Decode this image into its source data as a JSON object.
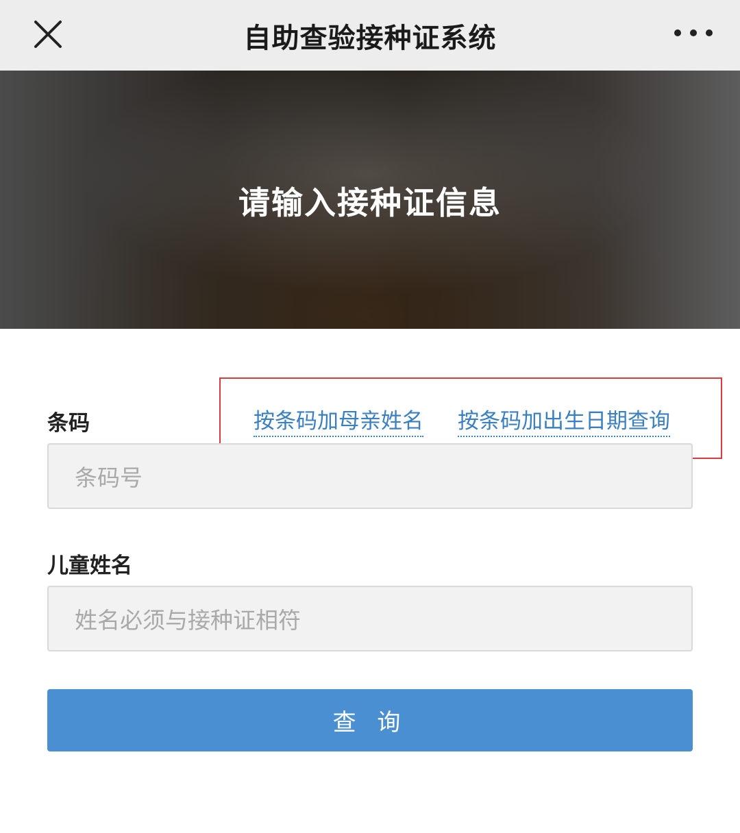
{
  "header": {
    "title": "自助查验接种证系统",
    "close_icon": "close-icon",
    "more_icon": "more-dots-icon"
  },
  "hero": {
    "title": "请输入接种证信息"
  },
  "form": {
    "barcode_label": "条码",
    "link_mother_name": "按条码加母亲姓名",
    "link_birth_date": "按条码加出生日期查询",
    "barcode_placeholder": "条码号",
    "child_name_label": "儿童姓名",
    "child_name_placeholder": "姓名必须与接种证相符",
    "query_button": "查 询"
  },
  "colors": {
    "link": "#3a7fc1",
    "button": "#4a8fd2",
    "highlight_box": "#e0393b"
  }
}
